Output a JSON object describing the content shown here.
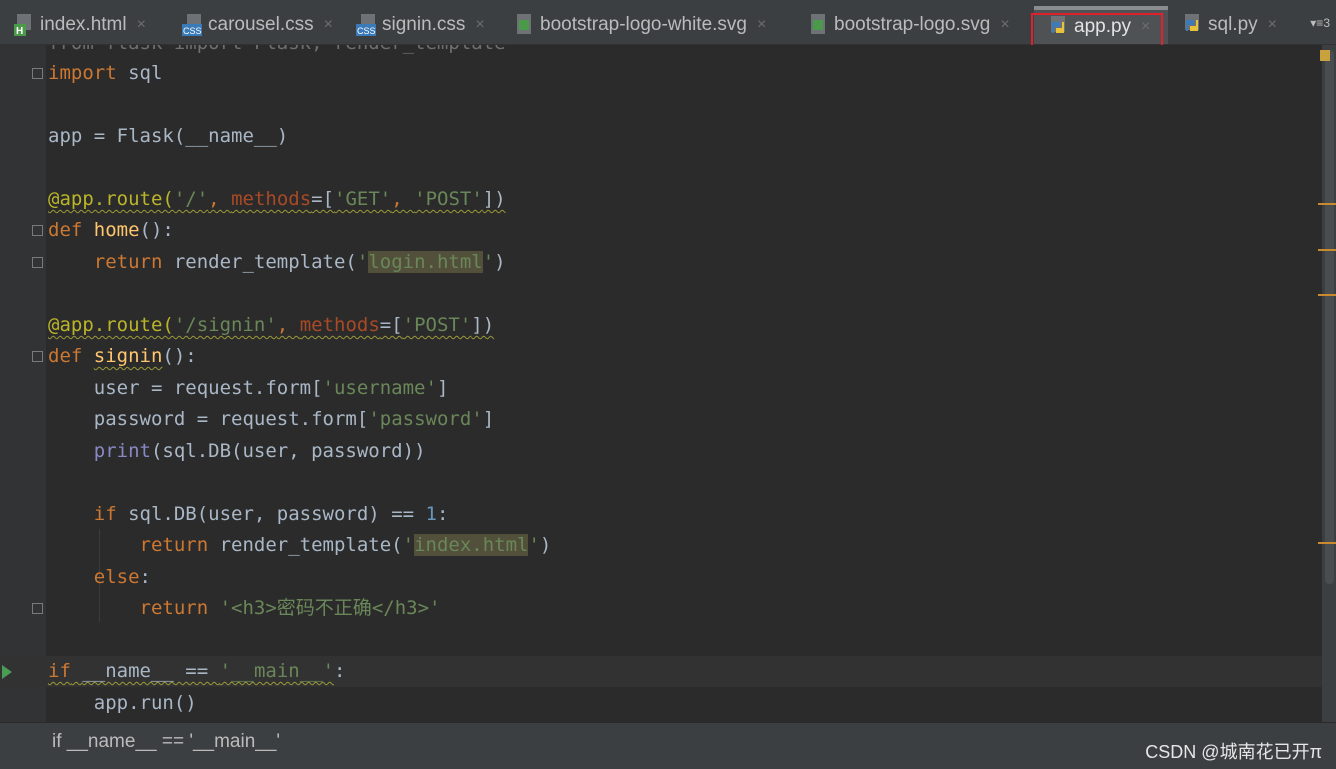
{
  "tabs": [
    {
      "label": "index.html",
      "icon": "html-file-icon",
      "active": false
    },
    {
      "label": "carousel.css",
      "icon": "css-file-icon",
      "active": false
    },
    {
      "label": "signin.css",
      "icon": "css-file-icon",
      "active": false
    },
    {
      "label": "bootstrap-logo-white.svg",
      "icon": "svg-file-icon",
      "active": false
    },
    {
      "label": "bootstrap-logo.svg",
      "icon": "svg-file-icon",
      "active": false
    },
    {
      "label": "app.py",
      "icon": "python-file-icon",
      "active": true
    },
    {
      "label": "sql.py",
      "icon": "python-file-icon",
      "active": false
    }
  ],
  "tab_close_glyph": "×",
  "tab_overflow": {
    "glyph": "▾≡",
    "count": "3"
  },
  "code": {
    "line0": "from flask import Flask, render_template",
    "l_import": "import",
    "l_sql": " sql",
    "l_app": "app = Flask(__name__)",
    "l_deco1": "@app.route(",
    "l_deco1_path": "'/'",
    "l_comma": ", ",
    "l_methods": "methods",
    "l_eq": "=[",
    "l_get": "'GET'",
    "l_post": "'POST'",
    "l_close": "])",
    "l_def": "def ",
    "l_home": "home",
    "l_paren": "():",
    "l_return": "return ",
    "l_rt": "render_template(",
    "l_quote": "'",
    "l_login": "login.html",
    "l_rparen": ")",
    "l_signin_path": "'/signin'",
    "l_signin": "signin",
    "l_user": "user = request.form[",
    "l_username": "'username'",
    "l_rbr": "]",
    "l_pwd": "password = request.form[",
    "l_password": "'password'",
    "l_print": "print",
    "l_printargs": "(sql.DB(user, password))",
    "l_if": "if ",
    "l_ifcond": "sql.DB(user, password) == ",
    "l_one": "1",
    "l_colon": ":",
    "l_index": "index.html",
    "l_else": "else",
    "l_h3open": "'<h3>",
    "l_h3text": "密码不正确",
    "l_h3close": "</h3>'",
    "l_main_if": "if",
    "l_main_name": "__name__",
    "l_main_eq": " == ",
    "l_main_str": "'__main__'",
    "l_run": "app.run()"
  },
  "breadcrumb": "if __name__ == '__main__'",
  "watermark": "CSDN @城南花已开π",
  "colors": {
    "keyword": "#cc7832",
    "string": "#6a8759",
    "decorator": "#bbb529",
    "number": "#6897bb",
    "highlight_box": "#e0202c"
  }
}
